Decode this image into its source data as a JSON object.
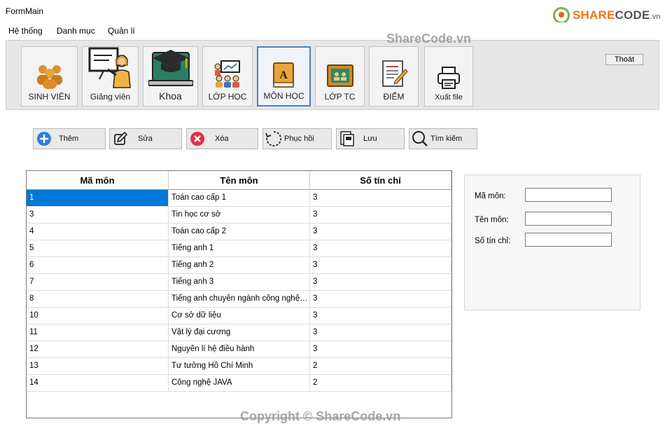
{
  "window": {
    "title": "FormMain"
  },
  "brand": {
    "name_orange": "SHARE",
    "name_dark": "CODE",
    "suffix": ".vn"
  },
  "menu": [
    "Hệ thống",
    "Danh mục",
    "Quản lí"
  ],
  "toolbar": {
    "buttons": [
      {
        "label": "SINH VIÊN",
        "icon": "students-icon"
      },
      {
        "label": "Giảng viên",
        "icon": "teacher-icon"
      },
      {
        "label": "Khoa",
        "icon": "graduation-laptop-icon"
      },
      {
        "label": "LỚP HỌC",
        "icon": "classroom-icon"
      },
      {
        "label": "MÔN HỌC",
        "icon": "book-icon"
      },
      {
        "label": "LỚP TC",
        "icon": "chalkboard-icon"
      },
      {
        "label": "ĐIỂM",
        "icon": "grade-sheet-icon"
      },
      {
        "label": "Xuất file",
        "icon": "printer-icon"
      }
    ],
    "exit_label": "Thoát"
  },
  "actions": [
    {
      "label": "Thêm",
      "icon": "plus-circle-icon"
    },
    {
      "label": "Sửa",
      "icon": "edit-icon"
    },
    {
      "label": "Xóa",
      "icon": "delete-circle-icon"
    },
    {
      "label": "Phục hồi",
      "icon": "restore-icon"
    },
    {
      "label": "Lưu",
      "icon": "save-icon"
    },
    {
      "label": "Tìm kiếm",
      "icon": "search-icon"
    }
  ],
  "table": {
    "columns": [
      "Mã môn",
      "Tên môn",
      "Số tín chỉ"
    ],
    "rows": [
      [
        "1",
        "Toán cao cấp 1",
        "3"
      ],
      [
        "3",
        "Tin học cơ sở",
        "3"
      ],
      [
        "4",
        "Toán cao cấp 2",
        "3"
      ],
      [
        "5",
        "Tiếng anh 1",
        "3"
      ],
      [
        "6",
        "Tiếng anh 2",
        "3"
      ],
      [
        "7",
        "Tiếng anh 3",
        "3"
      ],
      [
        "8",
        "Tiếng anh chuyên ngành công nghệ th...",
        "3"
      ],
      [
        "10",
        "Cơ sở dữ liệu",
        "3"
      ],
      [
        "11",
        "Vật lý đại cương",
        "3"
      ],
      [
        "12",
        "Nguyên lí hệ điều hành",
        "3"
      ],
      [
        "13",
        "Tư tưởng Hồ Chí Minh",
        "2"
      ],
      [
        "14",
        "Công nghệ JAVA",
        "2"
      ]
    ],
    "selected_row": 0
  },
  "form": {
    "fields": [
      {
        "label": "Mã môn:",
        "value": ""
      },
      {
        "label": "Tên môn:",
        "value": ""
      },
      {
        "label": "Số tín chỉ:",
        "value": ""
      }
    ]
  },
  "watermarks": {
    "top": "ShareCode.vn",
    "bottom": "Copyright © ShareCode.vn"
  },
  "colors": {
    "selection": "#0078d7",
    "brand_orange": "#f0761a",
    "brand_green": "#7ab648",
    "active_border": "#4a7fc1"
  }
}
